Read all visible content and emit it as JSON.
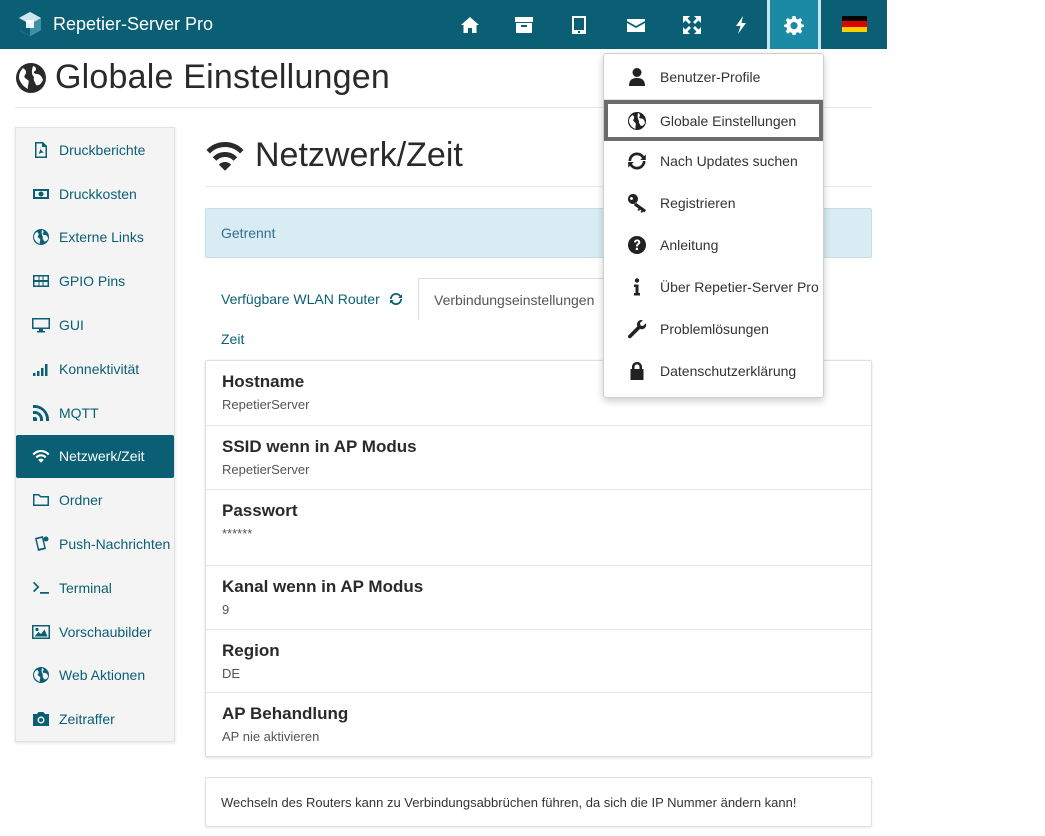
{
  "app": {
    "title": "Repetier-Server Pro"
  },
  "nav": {
    "icons": [
      "home-icon",
      "archive-icon",
      "tablet-icon",
      "envelope-icon",
      "expand-icon",
      "bolt-icon",
      "gear-icon",
      "german-flag-icon"
    ],
    "active": "gear-icon",
    "flag_colors": [
      "#000000",
      "#dd0000",
      "#ffce00"
    ]
  },
  "page": {
    "title": "Globale Einstellungen"
  },
  "sidebar": {
    "items": [
      {
        "label": "Druckberichte",
        "icon": "file-pdf-icon"
      },
      {
        "label": "Druckkosten",
        "icon": "money-icon"
      },
      {
        "label": "Externe Links",
        "icon": "globe-icon"
      },
      {
        "label": "GPIO Pins",
        "icon": "grid-icon"
      },
      {
        "label": "GUI",
        "icon": "monitor-icon"
      },
      {
        "label": "Konnektivität",
        "icon": "signal-icon"
      },
      {
        "label": "MQTT",
        "icon": "rss-icon"
      },
      {
        "label": "Netzwerk/Zeit",
        "icon": "wifi-icon"
      },
      {
        "label": "Ordner",
        "icon": "folder-icon"
      },
      {
        "label": "Push-Nachrichten",
        "icon": "phone-notification-icon"
      },
      {
        "label": "Terminal",
        "icon": "terminal-icon"
      },
      {
        "label": "Vorschaubilder",
        "icon": "image-icon"
      },
      {
        "label": "Web Aktionen",
        "icon": "globe-icon"
      },
      {
        "label": "Zeitraffer",
        "icon": "camera-icon"
      }
    ],
    "active_index": 7
  },
  "section": {
    "title": "Netzwerk/Zeit"
  },
  "status": {
    "text": "Getrennt"
  },
  "tabs": [
    {
      "label": "Verfügbare WLAN Router",
      "icon": "refresh-icon"
    },
    {
      "label": "Verbindungseinstellungen"
    },
    {
      "label": "Zeit"
    }
  ],
  "fields": [
    {
      "label": "Hostname",
      "value": "RepetierServer"
    },
    {
      "label": "SSID wenn in AP Modus",
      "value": "RepetierServer"
    },
    {
      "label": "Passwort",
      "value": "******"
    },
    {
      "label": "Kanal wenn in AP Modus",
      "value": "9"
    },
    {
      "label": "Region",
      "value": "DE"
    },
    {
      "label": "AP Behandlung",
      "value": "AP nie aktivieren"
    }
  ],
  "note": {
    "text": "Wechseln des Routers kann zu Verbindungsabbrüchen führen, da sich die IP Nummer ändern kann!"
  },
  "menu": {
    "items": [
      {
        "label": "Benutzer-Profile",
        "icon": "user-icon"
      },
      {
        "label": "Globale Einstellungen",
        "icon": "globe-icon"
      },
      {
        "label": "Nach Updates suchen",
        "icon": "refresh-icon"
      },
      {
        "label": "Registrieren",
        "icon": "key-icon"
      },
      {
        "label": "Anleitung",
        "icon": "question-icon"
      },
      {
        "label": "Über Repetier-Server Pro",
        "icon": "info-icon"
      },
      {
        "label": "Problemlösungen",
        "icon": "wrench-icon"
      },
      {
        "label": "Datenschutzerklärung",
        "icon": "lock-icon"
      }
    ],
    "selected_index": 1
  },
  "colors": {
    "navbar": "#0b5f75",
    "accent": "#1a8aa5",
    "alert_bg": "#d9ecf3"
  }
}
